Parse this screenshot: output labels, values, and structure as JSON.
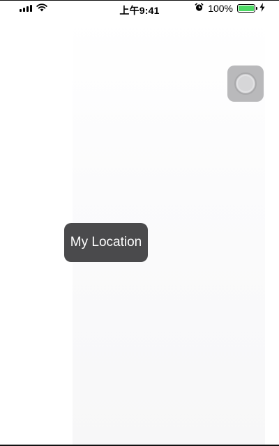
{
  "status_bar": {
    "time": "上午9:41",
    "battery_percent": "100%",
    "battery_level": 1.0,
    "battery_color": "#4cd964",
    "icons": [
      "signal-icon",
      "wifi-icon",
      "alarm-icon",
      "battery-icon",
      "charging-icon"
    ]
  },
  "map": {
    "locate_button": {
      "icon": "location-target-icon",
      "color": "#b9b9bb"
    },
    "tooltip": {
      "label": "My Location",
      "background": "#4a4a4c"
    }
  }
}
